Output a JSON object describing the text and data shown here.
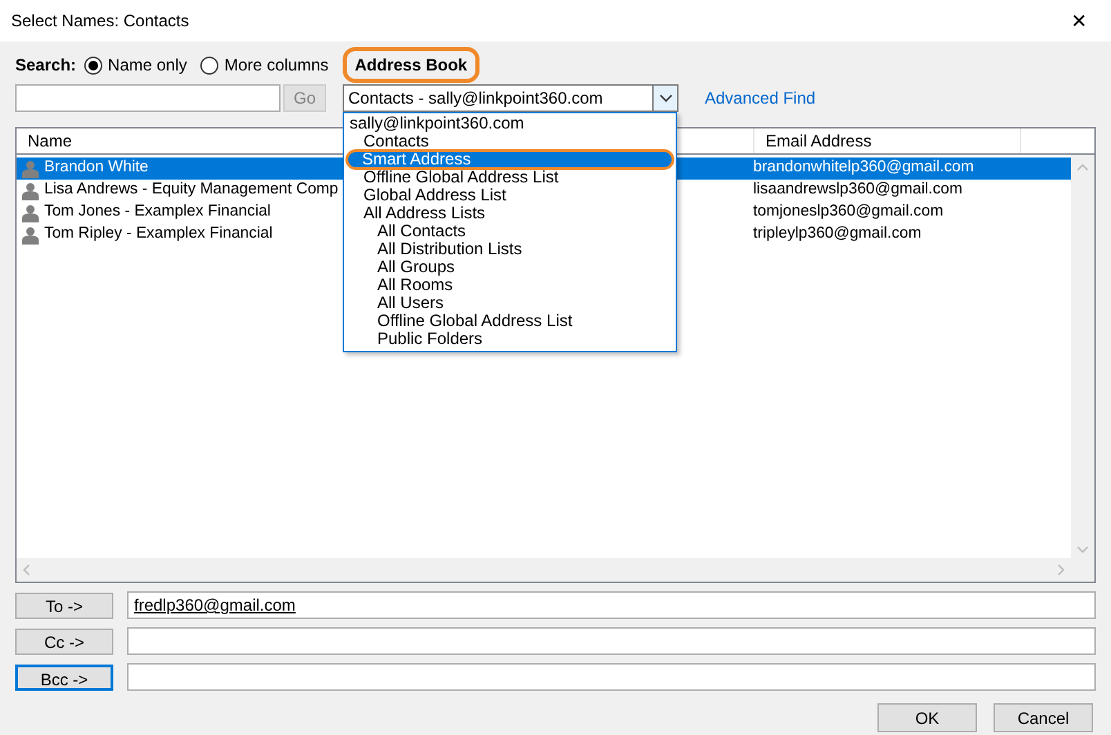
{
  "window": {
    "title": "Select Names: Contacts",
    "close": "✕"
  },
  "search": {
    "label": "Search:",
    "options": [
      {
        "label": "Name only",
        "selected": true
      },
      {
        "label": "More columns",
        "selected": false
      }
    ],
    "address_book_label": "Address Book",
    "address_book_highlighted": true
  },
  "query": {
    "go": "Go",
    "go_disabled": true
  },
  "address_book": {
    "value": "Contacts - sally@linkpoint360.com",
    "expanded": true,
    "items": [
      {
        "label": "sally@linkpoint360.com",
        "selected": false,
        "highlighted": false,
        "children": [
          {
            "label": "Contacts",
            "selected": false,
            "highlighted": false
          },
          {
            "label": "Smart Address",
            "selected": true,
            "highlighted": true
          },
          {
            "label": "Offline Global Address List",
            "selected": false,
            "highlighted": false
          },
          {
            "label": "Global Address List",
            "selected": false,
            "highlighted": false
          },
          {
            "label": "All Address Lists",
            "selected": false,
            "highlighted": false,
            "children": [
              {
                "label": "All Contacts",
                "selected": false,
                "highlighted": false
              },
              {
                "label": "All Distribution Lists",
                "selected": false,
                "highlighted": false
              },
              {
                "label": "All Groups",
                "selected": false,
                "highlighted": false
              },
              {
                "label": "All Rooms",
                "selected": false,
                "highlighted": false
              },
              {
                "label": "All Users",
                "selected": false,
                "highlighted": false
              },
              {
                "label": "Offline Global Address List",
                "selected": false,
                "highlighted": false
              },
              {
                "label": "Public Folders",
                "selected": false,
                "highlighted": false
              }
            ]
          }
        ]
      }
    ]
  },
  "advanced_find": "Advanced Find",
  "table": {
    "columns": [
      "Name",
      "Email Address"
    ],
    "rows": [
      {
        "name": "Brandon White",
        "email": "brandonwhitelp360@gmail.com",
        "selected": true
      },
      {
        "name": "Lisa Andrews - Equity Management Comp",
        "email": "lisaandrewslp360@gmail.com",
        "selected": false
      },
      {
        "name": "Tom Jones - Examplex Financial",
        "email": "tomjoneslp360@gmail.com",
        "selected": false
      },
      {
        "name": "Tom Ripley - Examplex Financial",
        "email": "tripleylp360@gmail.com",
        "selected": false
      }
    ]
  },
  "recipients": [
    {
      "button": "To ->",
      "value": "fredlp360@gmail.com",
      "focused": false
    },
    {
      "button": "Cc ->",
      "focused": false
    },
    {
      "button": "Bcc ->",
      "focused": true
    }
  ],
  "buttons": [
    "OK",
    "Cancel"
  ]
}
